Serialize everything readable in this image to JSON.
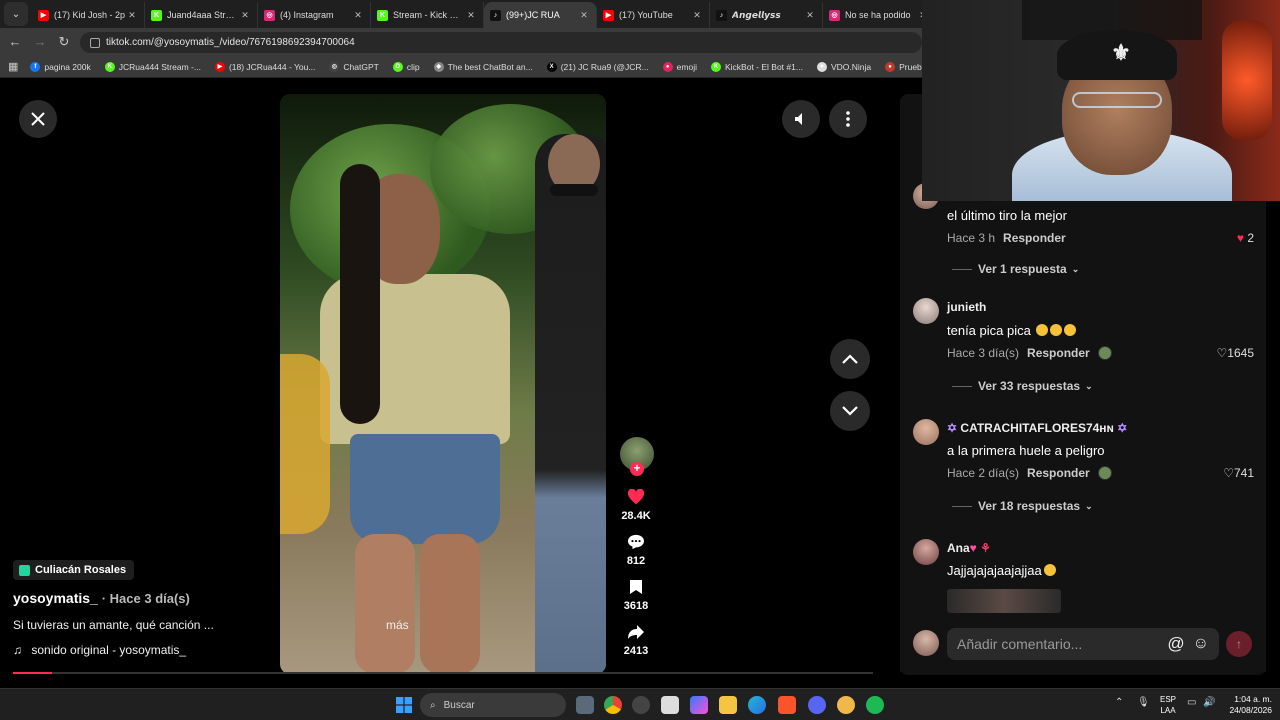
{
  "browser": {
    "tabs": [
      {
        "title": "(17) Kid Josh - 2p",
        "favicon_color": "#ff0000",
        "favicon_glyph": "▶"
      },
      {
        "title": "Juand4aaa Stream",
        "favicon_color": "#53fc18",
        "favicon_glyph": "K"
      },
      {
        "title": "(4) Instagram",
        "favicon_color": "#d62976",
        "favicon_glyph": "◎"
      },
      {
        "title": "Stream - Kick Das",
        "favicon_color": "#53fc18",
        "favicon_glyph": "K"
      },
      {
        "title": "(99+)JC RUA",
        "favicon_color": "#111111",
        "favicon_glyph": "♪",
        "active": true
      },
      {
        "title": "(17) YouTube",
        "favicon_color": "#ff0000",
        "favicon_glyph": "▶"
      },
      {
        "title": "𝘼𝙣𝙜𝙚𝙡𝙡𝙮𝙨𝙨",
        "favicon_color": "#111111",
        "favicon_glyph": "♪"
      },
      {
        "title": "No se ha podido",
        "favicon_color": "#d62976",
        "favicon_glyph": "◎"
      }
    ],
    "url": "tiktok.com/@yosoymatis_/video/7676198692394700064",
    "bookmarks": [
      {
        "label": "pagina 200k",
        "color": "#1877f2",
        "glyph": "f"
      },
      {
        "label": "JCRua444 Stream -...",
        "color": "#53fc18",
        "glyph": "K"
      },
      {
        "label": "(18) JCRua444 - You...",
        "color": "#ff0000",
        "glyph": "▶"
      },
      {
        "label": "ChatGPT",
        "color": "#444444",
        "glyph": "◎"
      },
      {
        "label": "clip",
        "color": "#53fc18",
        "glyph": "D"
      },
      {
        "label": "The best ChatBot an...",
        "color": "#888888",
        "glyph": "◆"
      },
      {
        "label": "(21) JC Rua9 (@JCR...",
        "color": "#000000",
        "glyph": "X"
      },
      {
        "label": "emoji",
        "color": "#e0245e",
        "glyph": "●"
      },
      {
        "label": "KickBot - El Bot #1...",
        "color": "#53fc18",
        "glyph": "K"
      },
      {
        "label": "VDO.Ninja",
        "color": "#dddddd",
        "glyph": "✦"
      },
      {
        "label": "Prueba de velocida...",
        "color": "#c0392b",
        "glyph": "●"
      }
    ]
  },
  "video": {
    "more_label": "más",
    "location": "Culiacán Rosales",
    "author": "yosoymatis_",
    "posted": "· Hace 3 día(s)",
    "caption": "Si tuvieras un amante, qué canción ...",
    "sound": "sonido original - yosoymatis_",
    "progress_fraction": 0.045
  },
  "actions": {
    "likes": "28.4K",
    "comments": "812",
    "saves": "3618",
    "shares": "2413"
  },
  "comments": [
    {
      "user": "",
      "text": "el último tiro la mejor",
      "time": "Hace 3 h",
      "likes": "2",
      "liked": true,
      "replies": "Ver 1 respuesta"
    },
    {
      "user": "junieth",
      "text": "tenía pica pica",
      "time": "Hace 3 día(s)",
      "likes": "1645",
      "liked": false,
      "replies": "Ver 33 respuestas"
    },
    {
      "user": "CATRACHITAFLORES74ʜɴ",
      "text": "a la primera huele a peligro",
      "time": "Hace 2 día(s)",
      "likes": "741",
      "liked": false,
      "replies": "Ver 18 respuestas"
    },
    {
      "user": "Ana",
      "text": "Jajjajajajaajajjaa",
      "time": "",
      "likes": "",
      "liked": false,
      "replies": ""
    }
  ],
  "comment_ui": {
    "reply_label": "Responder",
    "input_placeholder": "Añadir comentario..."
  },
  "taskbar": {
    "search_label": "Buscar",
    "lang_line1": "ESP",
    "lang_line2": "LAA",
    "time": "1:04 a. m.",
    "date": "24/08/2026"
  },
  "colors": {
    "accent": "#fe2c55",
    "location_pin": "#20d5a0"
  }
}
